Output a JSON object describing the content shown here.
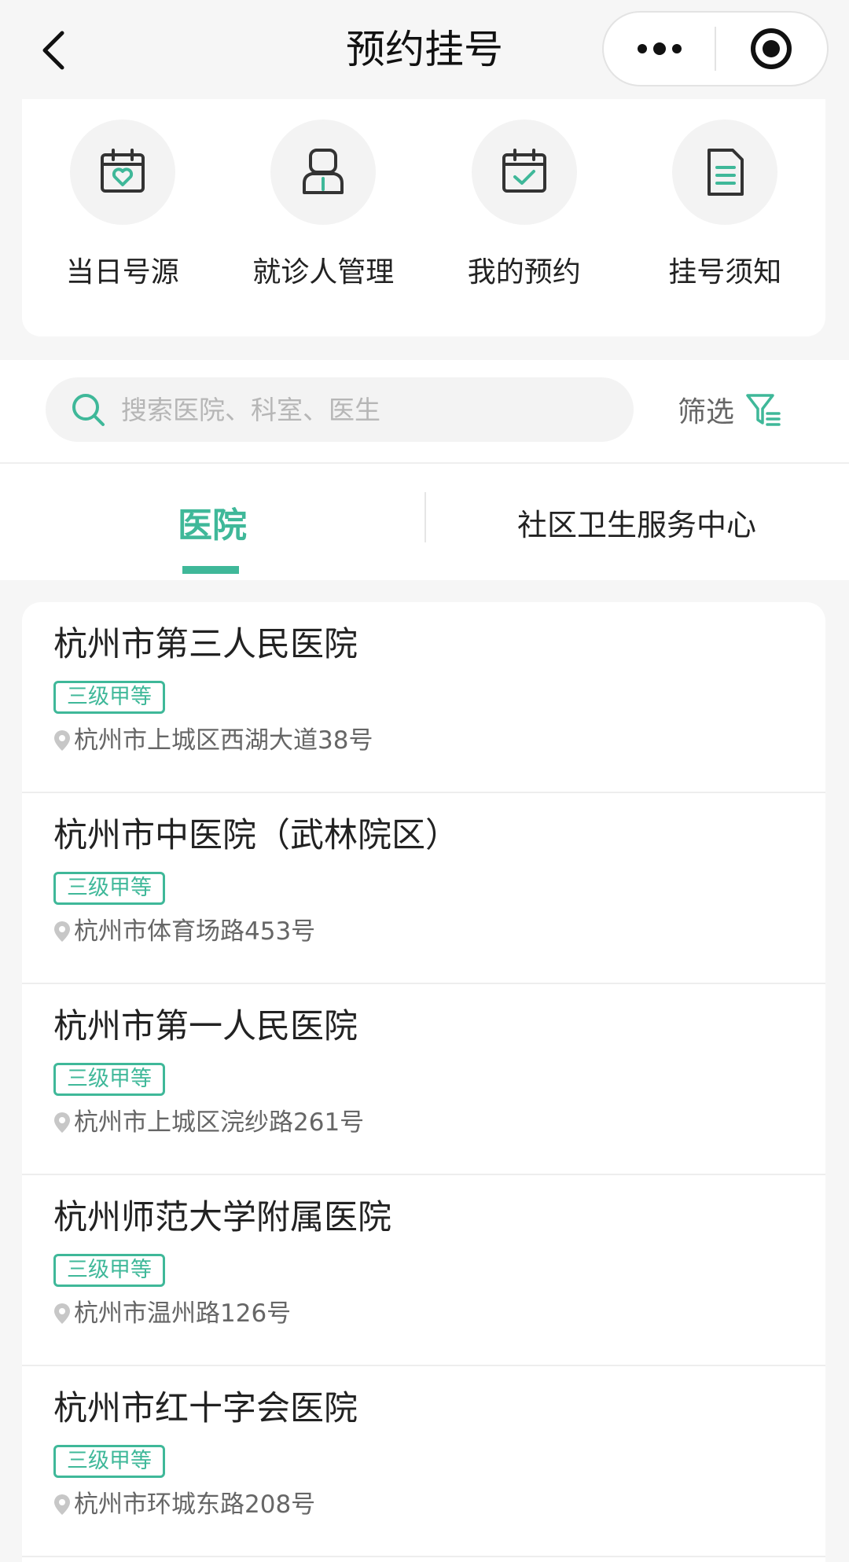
{
  "navbar": {
    "title": "预约挂号",
    "back_icon": "chevron-left-icon",
    "more_icon": "more-dots-icon",
    "close_icon": "target-icon"
  },
  "shortcuts": [
    {
      "label": "当日号源",
      "icon": "calendar-heart-icon"
    },
    {
      "label": "就诊人管理",
      "icon": "patient-icon"
    },
    {
      "label": "我的预约",
      "icon": "calendar-check-icon"
    },
    {
      "label": "挂号须知",
      "icon": "document-icon"
    }
  ],
  "search": {
    "placeholder": "搜索医院、科室、医生",
    "value": ""
  },
  "filter": {
    "label": "筛选",
    "icon": "filter-icon"
  },
  "tabs": [
    {
      "label": "医院",
      "active": true
    },
    {
      "label": "社区卫生服务中心",
      "active": false
    }
  ],
  "hospitals": [
    {
      "name": "杭州市第三人民医院",
      "level": "三级甲等",
      "address": "杭州市上城区西湖大道38号"
    },
    {
      "name": "杭州市中医院（武林院区）",
      "level": "三级甲等",
      "address": "杭州市体育场路453号"
    },
    {
      "name": "杭州市第一人民医院",
      "level": "三级甲等",
      "address": "杭州市上城区浣纱路261号"
    },
    {
      "name": "杭州师范大学附属医院",
      "level": "三级甲等",
      "address": "杭州市温州路126号"
    },
    {
      "name": "杭州市红十字会医院",
      "level": "三级甲等",
      "address": "杭州市环城东路208号"
    }
  ],
  "colors": {
    "accent": "#3fb899",
    "background": "#f6f6f6",
    "card": "#ffffff"
  }
}
